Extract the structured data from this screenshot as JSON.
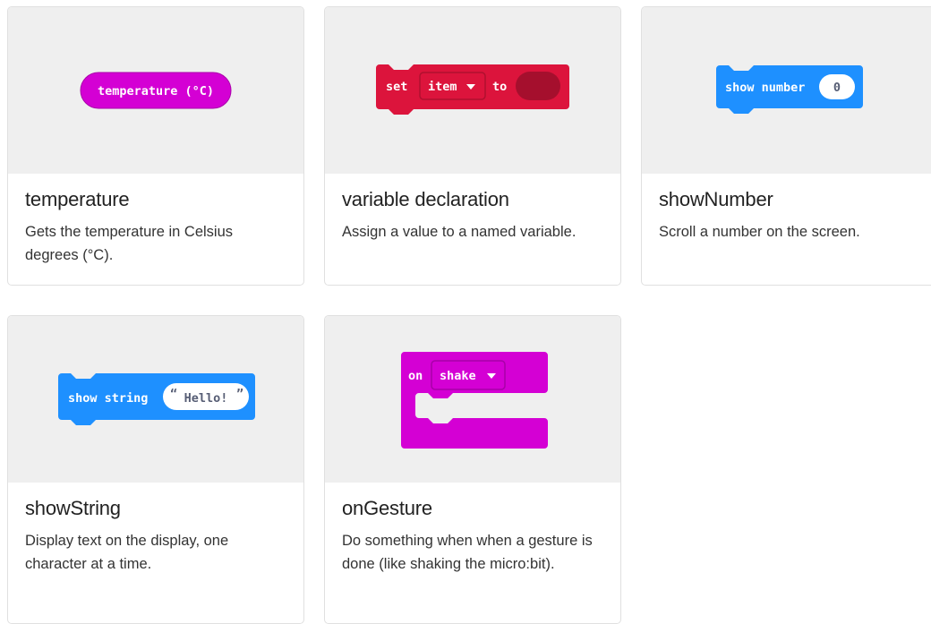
{
  "cards": [
    {
      "title": "temperature",
      "description": "Gets the temperature in Celsius degrees (°C).",
      "block": {
        "label": "temperature (°C)",
        "color": "#d400d4"
      }
    },
    {
      "title": "variable declaration",
      "description": "Assign a value to a named variable.",
      "block": {
        "set_label": "set",
        "variable": "item",
        "to_label": "to",
        "color": "#dc143c"
      }
    },
    {
      "title": "showNumber",
      "description": "Scroll a number on the screen.",
      "block": {
        "label": "show number",
        "value": "0",
        "color": "#1e90ff"
      }
    },
    {
      "title": "showString",
      "description": "Display text on the display, one character at a time.",
      "block": {
        "label": "show string",
        "value": "Hello!",
        "color": "#1e90ff"
      }
    },
    {
      "title": "onGesture",
      "description": "Do something when when a gesture is done (like shaking the micro:bit).",
      "block": {
        "on_label": "on",
        "gesture": "shake",
        "color": "#d400d4"
      }
    }
  ]
}
